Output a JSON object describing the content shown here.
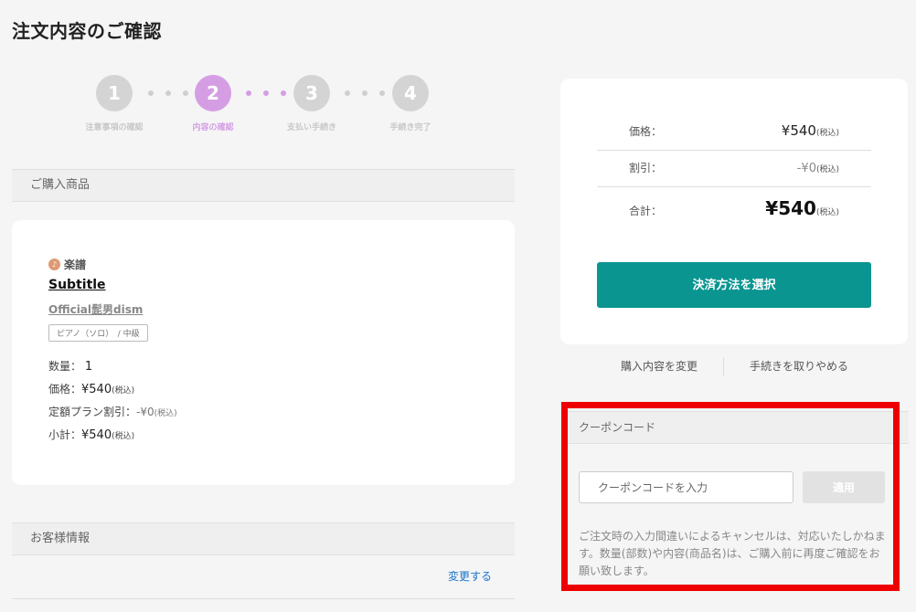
{
  "page": {
    "title": "注文内容のご確認"
  },
  "stepper": {
    "steps": [
      {
        "number": "1",
        "label": "注意事項の確認"
      },
      {
        "number": "2",
        "label": "内容の確認"
      },
      {
        "number": "3",
        "label": "支払い手続き"
      },
      {
        "number": "4",
        "label": "手続き完了"
      }
    ],
    "active_step": 2
  },
  "purchased": {
    "header": "ご購入商品",
    "category": "楽譜",
    "title": "Subtitle",
    "artist": "Official髭男dism",
    "tag": "ピアノ（ソロ）　/ 中級",
    "quantity_label": "数量：",
    "quantity_value": "1",
    "price_label": "価格：",
    "price_value": "¥540",
    "price_tax": "(税込)",
    "discount_label": "定額プラン割引：",
    "discount_value": "-¥0",
    "discount_tax": "(税込)",
    "subtotal_label": "小計：",
    "subtotal_value": "¥540",
    "subtotal_tax": "(税込)"
  },
  "customer": {
    "header": "お客様情報",
    "change_link": "変更する"
  },
  "summary": {
    "price_label": "価格：",
    "price_value": "¥540",
    "price_tax": "(税込)",
    "discount_label": "割引：",
    "discount_value": "-¥0",
    "discount_tax": "(税込)",
    "total_label": "合計：",
    "total_value": "¥540",
    "total_tax": "(税込)",
    "pay_button": "決済方法を選択"
  },
  "links": {
    "change_order": "購入内容を変更",
    "cancel": "手続きを取りやめる"
  },
  "coupon": {
    "header": "クーポンコード",
    "placeholder": "クーポンコードを入力",
    "apply_button": "適用",
    "note": "ご注文時の入力間違いによるキャンセルは、対応いたしかねます。数量(部数)や内容(商品名)は、ご購入前に再度ご確認をお願い致します。"
  },
  "colors": {
    "accent_teal": "#0a9591",
    "step_active": "#d59ee4",
    "highlight_red": "#ee0000",
    "link_blue": "#1a73c9"
  }
}
